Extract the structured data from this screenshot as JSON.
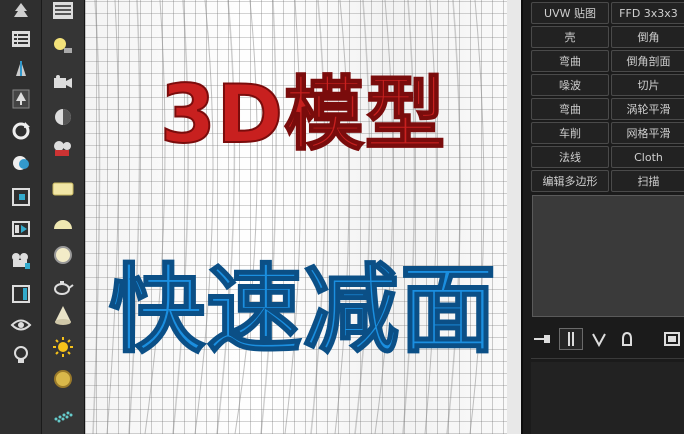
{
  "overlay": {
    "title": "3D模型",
    "subtitle": "快速减面",
    "title_color": "#c8201f",
    "subtitle_color": "#1b8fe0"
  },
  "modifiers": [
    {
      "left": "UVW 贴图",
      "right": "FFD 3x3x3"
    },
    {
      "left": "壳",
      "right": "倒角"
    },
    {
      "left": "弯曲",
      "right": "倒角剖面"
    },
    {
      "left": "噪波",
      "right": "切片"
    },
    {
      "left": "弯曲",
      "right": "涡轮平滑"
    },
    {
      "left": "车削",
      "right": "网格平滑"
    },
    {
      "left": "法线",
      "right": "Cloth"
    },
    {
      "left": "编辑多边形",
      "right": "扫描"
    }
  ],
  "toolbar_left": [
    "tree-icon",
    "list-panel-icon",
    "terrain-icon",
    "tree-small-icon",
    "rotate-icon",
    "object-color-icon",
    "frame-icon",
    "slide-icon",
    "camera-group-icon",
    "window-icon",
    "eye-icon",
    "lightbulb-icon"
  ],
  "toolbar_right": [
    "render-frame-icon",
    "light-bulb-icon",
    "camera-icon",
    "half-sphere-icon",
    "render-camera-icon",
    "plane-icon",
    "dome-icon",
    "sphere-icon",
    "teapot-icon",
    "cone-icon",
    "sun-icon",
    "sphere-gold-icon",
    "particles-icon"
  ],
  "stack_controls": [
    "pin-stack-icon",
    "show-end-result-icon",
    "make-unique-icon",
    "remove-modifier-icon",
    "configure-sets-icon"
  ]
}
